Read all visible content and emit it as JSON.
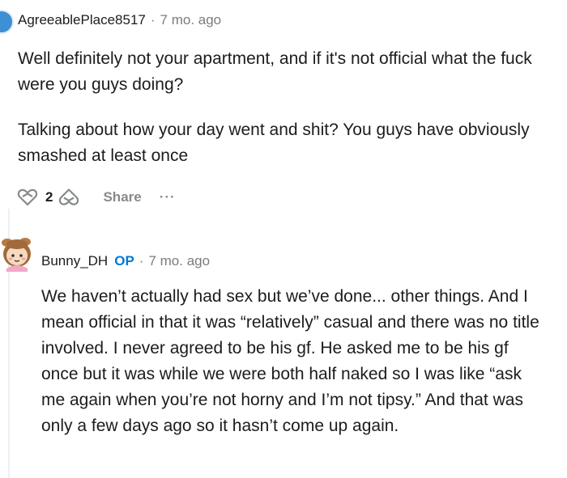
{
  "comments": [
    {
      "author": "AgreeablePlace8517",
      "separator": "·",
      "age": "7 mo. ago",
      "paragraphs": [
        "Well definitely not your apartment, and if it's not official what the fuck were you guys doing?",
        "Talking about how your day went and shit? You guys have obviously smashed at least once"
      ],
      "vote_count": "2",
      "share_label": "Share",
      "more_label": "···"
    },
    {
      "author": "Bunny_DH",
      "op_badge": "OP",
      "separator": "·",
      "age": "7 mo. ago",
      "paragraphs": [
        "We haven’t actually had sex but we’ve done... other things. And I mean official in that it was “relatively” casual and there was no title involved. I never agreed to be his gf. He asked me to be his gf once but it was while we were both half naked so I was like “ask me again when you’re not horny and I’m not tipsy.” And that was only a few days ago so it hasn’t come up again."
      ]
    }
  ],
  "colors": {
    "op_badge": "#0079d3",
    "meta_text": "#7c7c7c",
    "action_text": "#878a8c",
    "thread_line": "#edeff1"
  }
}
